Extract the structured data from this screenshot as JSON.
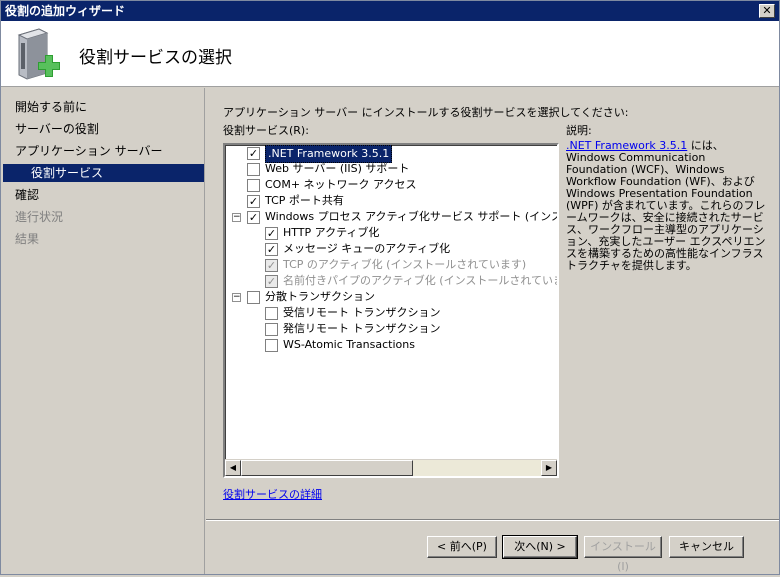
{
  "window": {
    "title": "役割の追加ウィザード",
    "close_glyph": "✕"
  },
  "header": {
    "title": "役割サービスの選択",
    "icon": "server-add-icon"
  },
  "nav": {
    "items": [
      {
        "label": "開始する前に",
        "state": "normal"
      },
      {
        "label": "サーバーの役割",
        "state": "normal"
      },
      {
        "label": "アプリケーション サーバー",
        "state": "normal"
      },
      {
        "label": "役割サービス",
        "state": "selected"
      },
      {
        "label": "確認",
        "state": "normal"
      },
      {
        "label": "進行状況",
        "state": "disabled"
      },
      {
        "label": "結果",
        "state": "disabled"
      }
    ]
  },
  "main": {
    "instruction": "アプリケーション サーバー にインストールする役割サービスを選択してください:",
    "services_label": "役割サービス(R):",
    "description_label": "説明:",
    "more_link": "役割サービスの詳細"
  },
  "tree": [
    {
      "label": ".NET Framework 3.5.1",
      "checked": true,
      "disabled": false,
      "level": 0,
      "selected": true,
      "expander": ""
    },
    {
      "label": "Web サーバー (IIS) サポート",
      "checked": false,
      "disabled": false,
      "level": 0,
      "selected": false,
      "expander": ""
    },
    {
      "label": "COM+ ネットワーク アクセス",
      "checked": false,
      "disabled": false,
      "level": 0,
      "selected": false,
      "expander": ""
    },
    {
      "label": "TCP ポート共有",
      "checked": true,
      "disabled": false,
      "level": 0,
      "selected": false,
      "expander": ""
    },
    {
      "label": "Windows プロセス アクティブ化サービス サポート (インストール",
      "checked": true,
      "disabled": false,
      "level": 0,
      "selected": false,
      "expander": "−"
    },
    {
      "label": "HTTP アクティブ化",
      "checked": true,
      "disabled": false,
      "level": 1,
      "selected": false,
      "expander": ""
    },
    {
      "label": "メッセージ キューのアクティブ化",
      "checked": true,
      "disabled": false,
      "level": 1,
      "selected": false,
      "expander": ""
    },
    {
      "label": "TCP のアクティブ化 (インストールされています)",
      "checked": true,
      "disabled": true,
      "level": 1,
      "selected": false,
      "expander": ""
    },
    {
      "label": "名前付きパイプのアクティブ化 (インストールされています)",
      "checked": true,
      "disabled": true,
      "level": 1,
      "selected": false,
      "expander": ""
    },
    {
      "label": "分散トランザクション",
      "checked": false,
      "disabled": false,
      "level": 0,
      "selected": false,
      "expander": "−"
    },
    {
      "label": "受信リモート トランザクション",
      "checked": false,
      "disabled": false,
      "level": 1,
      "selected": false,
      "expander": ""
    },
    {
      "label": "発信リモート トランザクション",
      "checked": false,
      "disabled": false,
      "level": 1,
      "selected": false,
      "expander": ""
    },
    {
      "label": "WS-Atomic Transactions",
      "checked": false,
      "disabled": false,
      "level": 1,
      "selected": false,
      "expander": ""
    }
  ],
  "description": {
    "link_text": ".NET Framework 3.5.1",
    "body": " には、Windows Communication Foundation (WCF)、Windows Workflow Foundation (WF)、および Windows Presentation Foundation (WPF) が含まれています。これらのフレームワークは、安全に接続されたサービス、ワークフロー主導型のアプリケーション、充実したユーザー エクスペリエンスを構築するための高性能なインフラストラクチャを提供します。"
  },
  "buttons": {
    "back": "< 前へ(P)",
    "next": "次へ(N) >",
    "install": "インストール(I)",
    "cancel": "キャンセル"
  },
  "scrollbar": {
    "left_arrow": "◀",
    "right_arrow": "▶"
  }
}
